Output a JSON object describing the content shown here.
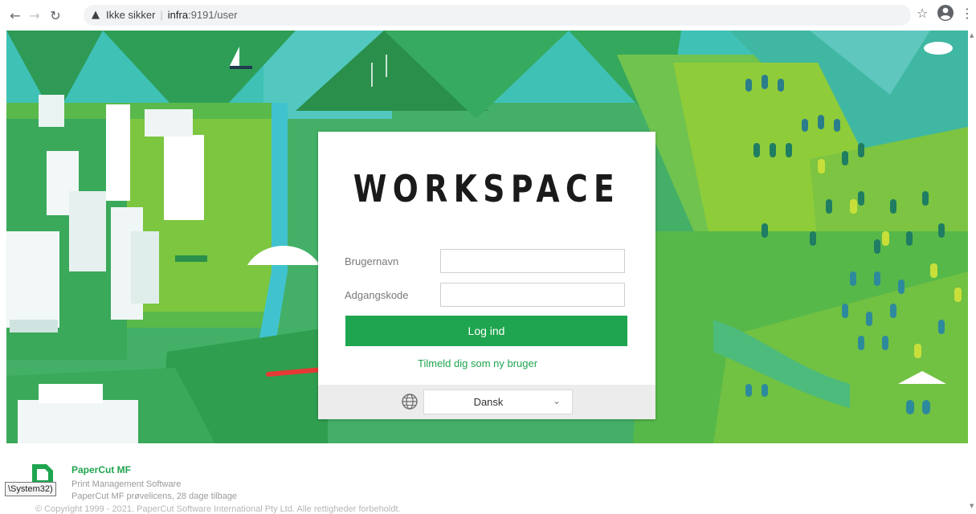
{
  "browser": {
    "security_label": "Ikke sikker",
    "url_host": "infra",
    "url_path": ":9191/user",
    "back_icon": "arrow-left-icon",
    "forward_icon": "arrow-right-icon",
    "reload_icon": "reload-icon",
    "star_icon": "star-icon",
    "account_icon": "account-icon",
    "menu_icon": "kebab-menu-icon"
  },
  "login": {
    "logo": "WORKSPACE",
    "username_label": "Brugernavn",
    "username_value": "",
    "password_label": "Adgangskode",
    "password_value": "",
    "submit_label": "Log ind",
    "signup_link": "Tilmeld dig som ny bruger",
    "language_value": "Dansk",
    "language_icon": "globe-icon"
  },
  "footer": {
    "product": "PaperCut MF",
    "subtitle": "Print Management Software",
    "license": "PaperCut MF prøvelicens, 28 dage tilbage",
    "copyright": "© Copyright 1999 - 2021. PaperCut Software International Pty Ltd. Alle rettigheder forbeholdt.",
    "tooltip": "\\System32)"
  },
  "colors": {
    "accent_green": "#1fa54f",
    "annotation_red": "#e53935"
  }
}
